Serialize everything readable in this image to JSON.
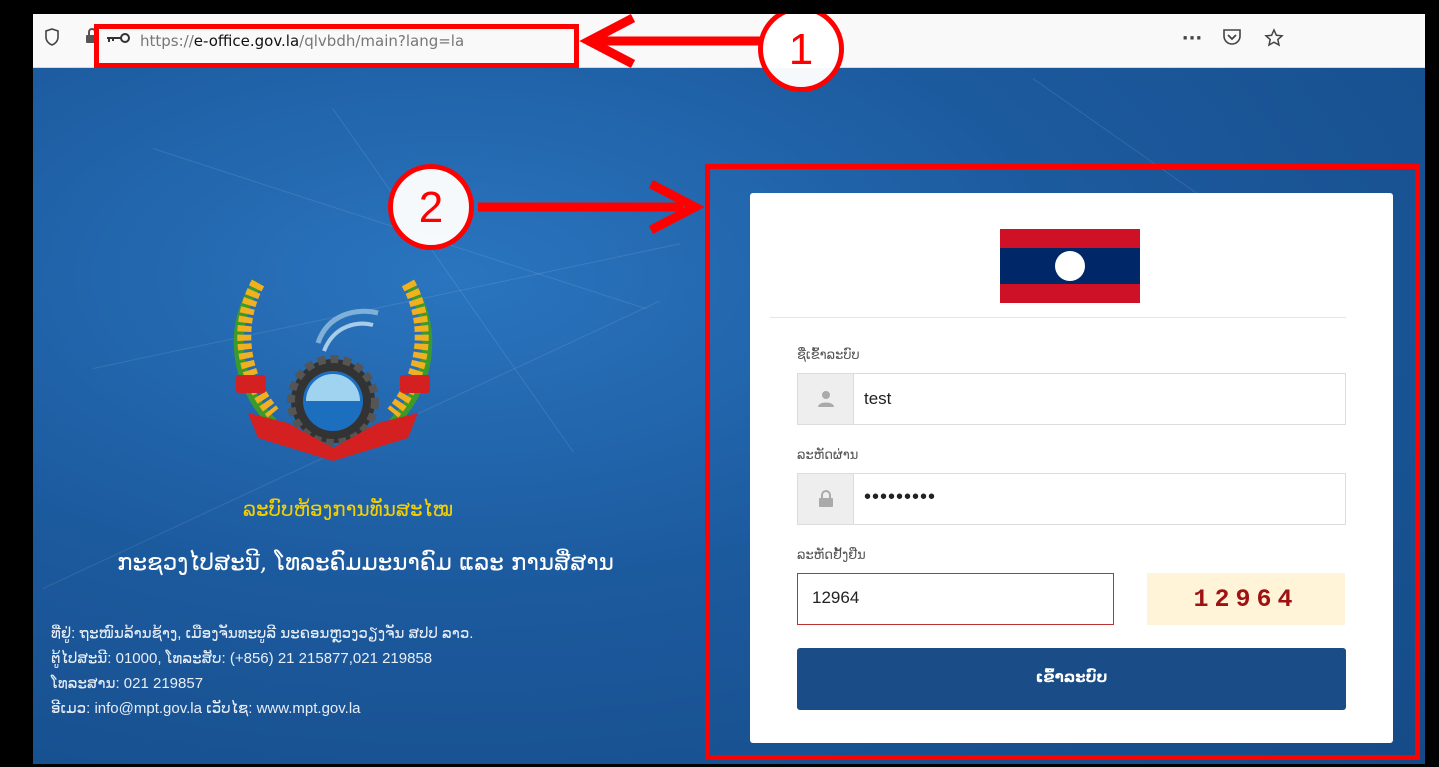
{
  "browser": {
    "url_prefix": "https://",
    "url_domain": "e-office.gov.la",
    "url_path": "/qlvbdh/main?lang=la",
    "menu_icon": "ellipsis-icon",
    "pocket_icon": "pocket-icon",
    "bookmark_icon": "star-icon"
  },
  "left": {
    "system_name": "ລະບົບຫ້ອງການທັນສະໄໝ",
    "ministry_name": "ກະຊວງໄປສະນີ, ໂທລະຄົມມະນາຄົມ ແລະ ການສື່ສານ",
    "address_lines": [
      "ທີ່ຢູ່: ຖະໜົນລ້ານຊ້າງ, ເມືອງຈັນທະບູລີ ນະຄອນຫຼວງວຽງຈັນ ສປປ ລາວ.",
      "ຕູ້ໄປສະນີ: 01000, ໂທລະສັບ: (+856) 21 215877,021 219858",
      "ໂທລະສານ: 021 219857",
      "ອີເມວ: info@mpt.gov.la ເວັບໄຊ: www.mpt.gov.la"
    ]
  },
  "login": {
    "username_label": "ຊື່ເຂົ້າລະບົບ",
    "username_value": "test",
    "password_label": "ລະຫັດຜ່ານ",
    "password_value": "•••••••••",
    "captcha_label": "ລະຫັດຢັ້ງຢືນ",
    "captcha_value": "12964",
    "captcha_image_text": "12964",
    "submit_label": "ເຂົ້າລະບົບ"
  },
  "annotations": {
    "marker_1": "1",
    "marker_2": "2"
  },
  "colors": {
    "annotation": "#ff0000",
    "button": "#1a4c87",
    "page_bg": "#1f5da0",
    "system_name": "#f5d000"
  }
}
